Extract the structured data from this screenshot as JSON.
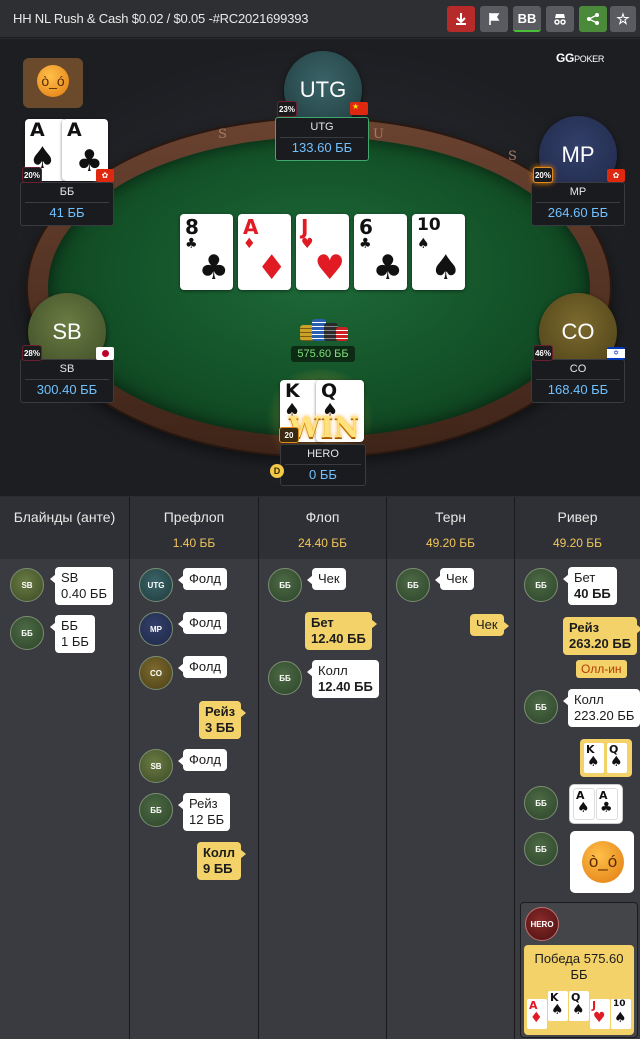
{
  "header": {
    "title": "HH NL Rush & Cash $0.02 / $0.05 -#RC2021699393",
    "buttons": [
      {
        "name": "download-button",
        "icon": "download-icon",
        "color": "#b62a2a"
      },
      {
        "name": "report-button",
        "icon": "flag-icon",
        "color": "#5a5b60"
      },
      {
        "name": "bb-toggle-button",
        "label": "BB",
        "color": "#5a5b60"
      },
      {
        "name": "incognito-button",
        "icon": "incognito-icon",
        "color": "#5a5b60"
      },
      {
        "name": "share-button",
        "icon": "share-icon",
        "color": "#4a8a3a"
      },
      {
        "name": "favorite-button",
        "icon": "star-icon",
        "color": "#5a5b60"
      }
    ]
  },
  "logo": "GGPOKER",
  "table": {
    "rail_letters": [
      "S",
      "U",
      "U",
      "S",
      "A",
      "S",
      "A"
    ],
    "pot": "575.60 ББ",
    "board": [
      {
        "rank": "8",
        "suit": "♣",
        "red": false
      },
      {
        "rank": "A",
        "suit": "♦",
        "red": true
      },
      {
        "rank": "J",
        "suit": "♥",
        "red": true
      },
      {
        "rank": "6",
        "suit": "♣",
        "red": false
      },
      {
        "rank": "10",
        "suit": "♠",
        "red": false
      }
    ],
    "win_text": "WIN",
    "seats": {
      "utg": {
        "avatar": "UTG",
        "name": "UTG",
        "stack": "133.60 ББ",
        "pct": "23%",
        "flag": "china",
        "color": "#2f4f52"
      },
      "bb": {
        "name": "ББ",
        "stack": "41 ББ",
        "pct": "20%",
        "flag": "hongkong",
        "cards": [
          {
            "rank": "A",
            "suit": "♠"
          },
          {
            "rank": "A",
            "suit": "♣"
          }
        ]
      },
      "mp": {
        "avatar": "MP",
        "name": "MP",
        "stack": "264.60 ББ",
        "pct": "20%",
        "flag": "hongkong",
        "color": "#2a3558"
      },
      "sb": {
        "avatar": "SB",
        "name": "SB",
        "stack": "300.40 ББ",
        "pct": "28%",
        "flag": "japan",
        "color": "#5b6b3a"
      },
      "co": {
        "avatar": "CO",
        "name": "CO",
        "stack": "168.40 ББ",
        "pct": "46%",
        "flag": "israel",
        "color": "#6b5a26"
      },
      "hero": {
        "name": "HERO",
        "stack": "0 ББ",
        "pct": "20",
        "cards": [
          {
            "rank": "K",
            "suit": "♠"
          },
          {
            "rank": "Q",
            "suit": "♠"
          }
        ]
      }
    }
  },
  "history": {
    "columns": [
      {
        "title": "Блайнды (анте)",
        "pot": ""
      },
      {
        "title": "Префлоп",
        "pot": "1.40 ББ"
      },
      {
        "title": "Флоп",
        "pot": "24.40 ББ"
      },
      {
        "title": "Терн",
        "pot": "49.20 ББ"
      },
      {
        "title": "Ривер",
        "pot": "49.20 ББ"
      }
    ],
    "blinds": [
      {
        "pos": "SB",
        "line1": "SB",
        "line2": "0.40 ББ"
      },
      {
        "pos": "ББ",
        "line1": "ББ",
        "line2": "1 ББ"
      }
    ],
    "preflop": [
      {
        "pos": "UTG",
        "text": "Фолд"
      },
      {
        "pos": "MP",
        "text": "Фолд"
      },
      {
        "pos": "CO",
        "text": "Фолд"
      },
      {
        "hero": true,
        "line1": "Рейз",
        "line2": "3 ББ"
      },
      {
        "pos": "SB",
        "text": "Фолд"
      },
      {
        "pos": "ББ",
        "line1": "Рейз",
        "line2": "12 ББ"
      },
      {
        "hero": true,
        "line1": "Колл",
        "line2": "9 ББ"
      }
    ],
    "flop": [
      {
        "pos": "ББ",
        "text": "Чек"
      },
      {
        "hero": true,
        "line1": "Бет",
        "line2": "12.40 ББ"
      },
      {
        "pos": "ББ",
        "line1": "Колл",
        "line2": "12.40 ББ"
      }
    ],
    "turn": [
      {
        "pos": "ББ",
        "text": "Чек"
      },
      {
        "hero": true,
        "text": "Чек"
      }
    ],
    "river": [
      {
        "pos": "ББ",
        "line1": "Бет",
        "line2": "40 ББ"
      },
      {
        "hero": true,
        "line1": "Рейз",
        "line2": "263.20 ББ",
        "tag": "Олл-ин"
      },
      {
        "pos": "ББ",
        "line1": "Колл",
        "line2": "223.20 ББ"
      },
      {
        "hero": true,
        "cards": [
          "K♠",
          "Q♠"
        ]
      },
      {
        "pos": "ББ",
        "cards": [
          "A♠",
          "A♣"
        ]
      },
      {
        "pos": "ББ",
        "emoji": "angry-face"
      },
      {
        "pos": "HERO",
        "result": "Победа 575.60 ББ",
        "cards": [
          "A♦",
          "K♠",
          "Q♠",
          "J♥",
          "10♠"
        ]
      }
    ]
  }
}
